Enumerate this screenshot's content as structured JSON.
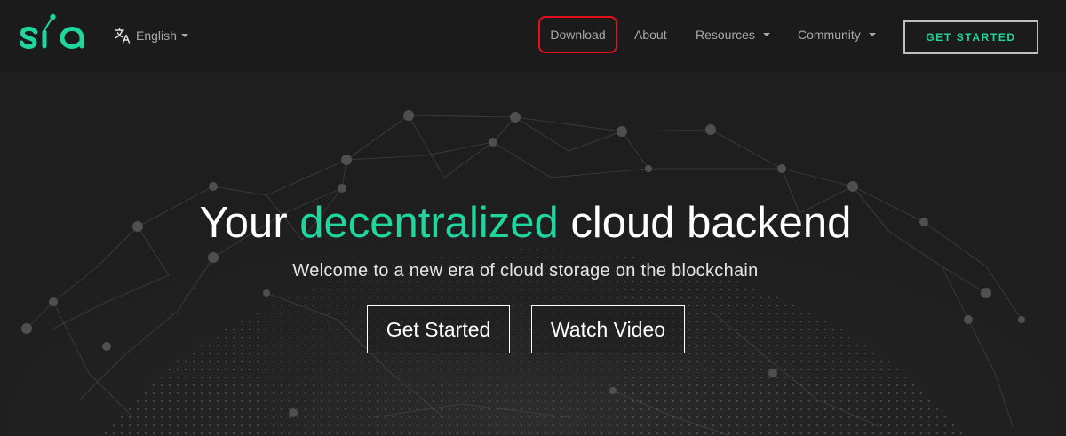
{
  "header": {
    "logo_text": "sia",
    "language": {
      "label": "English",
      "icon": "translate-icon"
    },
    "nav": {
      "download": "Download",
      "about": "About",
      "resources": "Resources",
      "community": "Community"
    },
    "cta_label": "GET STARTED"
  },
  "hero": {
    "title_prefix": "Your ",
    "title_accent": "decentralized",
    "title_suffix": " cloud backend",
    "subtitle": "Welcome to a new era of cloud storage on the blockchain",
    "primary_button": "Get Started",
    "secondary_button": "Watch Video"
  },
  "colors": {
    "brand_green": "#1ed69e",
    "background": "#1e1e1e",
    "highlight_border": "#e3101d"
  }
}
